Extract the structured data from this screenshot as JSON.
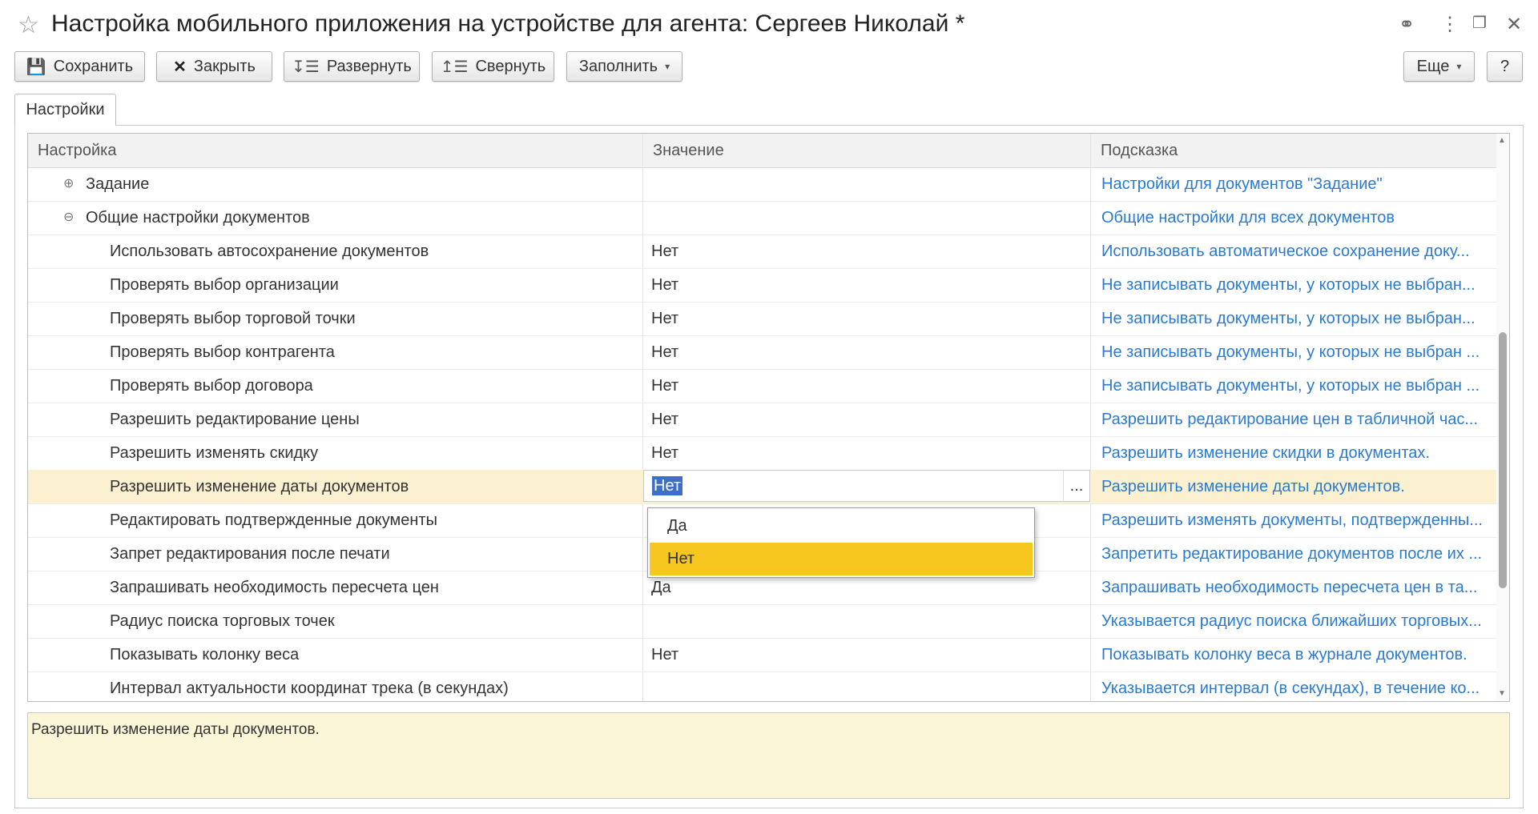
{
  "window": {
    "title": "Настройка мобильного приложения на устройстве для агента: Сергеев Николай *"
  },
  "toolbar": {
    "save_label": "Сохранить",
    "close_label": "Закрыть",
    "expand_label": "Развернуть",
    "collapse_label": "Свернуть",
    "fill_label": "Заполнить",
    "more_label": "Еще",
    "help_label": "?"
  },
  "tabs": [
    {
      "label": "Настройки"
    }
  ],
  "grid": {
    "columns": [
      "Настройка",
      "Значение",
      "Подсказка"
    ],
    "rows": [
      {
        "name": "Задание",
        "value": "",
        "hint": "Настройки для документов \"Задание\""
      },
      {
        "name": "Общие настройки документов",
        "value": "",
        "hint": "Общие настройки для всех документов"
      },
      {
        "name": "Использовать автосохранение документов",
        "value": "Нет",
        "hint": "Использовать автоматическое сохранение доку..."
      },
      {
        "name": "Проверять выбор организации",
        "value": "Нет",
        "hint": "Не записывать документы, у которых не выбран..."
      },
      {
        "name": "Проверять выбор торговой точки",
        "value": "Нет",
        "hint": "Не записывать документы, у которых не выбран..."
      },
      {
        "name": "Проверять выбор контрагента",
        "value": "Нет",
        "hint": "Не записывать документы, у которых не выбран ..."
      },
      {
        "name": "Проверять выбор договора",
        "value": "Нет",
        "hint": "Не записывать документы, у которых не выбран ..."
      },
      {
        "name": "Разрешить редактирование цены",
        "value": "Нет",
        "hint": "Разрешить редактирование цен в табличной час..."
      },
      {
        "name": "Разрешить изменять скидку",
        "value": "Нет",
        "hint": "Разрешить изменение скидки в документах."
      },
      {
        "name": "Разрешить изменение даты документов",
        "value": "Нет",
        "hint": "Разрешить изменение даты документов."
      },
      {
        "name": "Редактировать подтвержденные документы",
        "value": "",
        "hint": "Разрешить изменять документы, подтвержденны..."
      },
      {
        "name": "Запрет редактирования после печати",
        "value": "",
        "hint": "Запретить редактирование документов после их ..."
      },
      {
        "name": "Запрашивать необходимость пересчета цен",
        "value": "Да",
        "hint": "Запрашивать необходимость пересчета цен в та..."
      },
      {
        "name": "Радиус поиска торговых точек",
        "value": "",
        "hint": "Указывается радиус поиска ближайших торговых..."
      },
      {
        "name": "Показывать колонку веса",
        "value": "Нет",
        "hint": "Показывать колонку веса в журнале документов."
      },
      {
        "name": "Интервал актуальности координат трека (в секундах)",
        "value": "",
        "hint": "Указывается интервал (в секундах), в течение ко..."
      }
    ],
    "selected_index": 9,
    "editor_value": "Нет",
    "editor_button": "..."
  },
  "dropdown": {
    "options": [
      "Да",
      "Нет"
    ],
    "highlighted": "Нет"
  },
  "hint_panel": {
    "text": "Разрешить изменение даты документов."
  },
  "icons": {
    "star": "☆",
    "link": "🔗",
    "more": "⋮",
    "restore": "❐",
    "close": "✕",
    "plus": "⊕",
    "minus": "⊖"
  },
  "colors": {
    "selected_row": "#fbf1d1",
    "dropdown_active": "#f6c81f",
    "hint_link": "#2a7ad0",
    "hint_panel_bg": "#fbf6d8"
  }
}
